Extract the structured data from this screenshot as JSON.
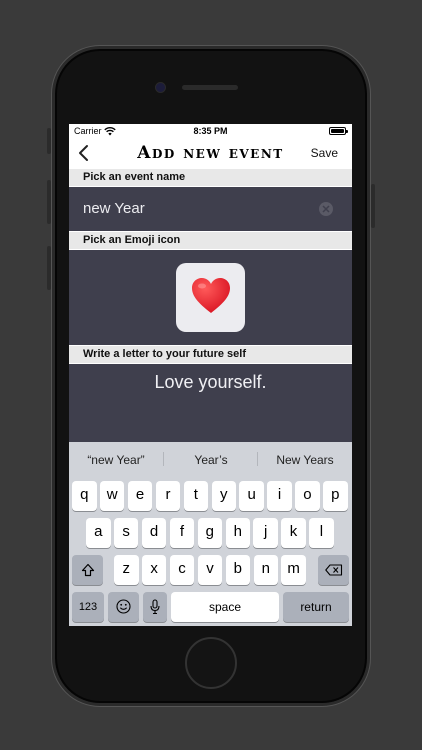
{
  "status_bar": {
    "carrier": "Carrier",
    "time": "8:35 PM"
  },
  "nav": {
    "title": "Add new event",
    "save_label": "Save"
  },
  "sections": {
    "event_name": "Pick an event name",
    "emoji": "Pick an Emoji icon",
    "letter": "Write a letter to your future self"
  },
  "event_name": {
    "value": "new Year"
  },
  "emoji": {
    "selected": "heart-icon",
    "color": "#e8182a"
  },
  "letter": {
    "text": "Love yourself."
  },
  "keyboard": {
    "suggestions": [
      "“new Year”",
      "Year’s",
      "New Years"
    ],
    "row1": [
      "q",
      "w",
      "e",
      "r",
      "t",
      "y",
      "u",
      "i",
      "o",
      "p"
    ],
    "row2": [
      "a",
      "s",
      "d",
      "f",
      "g",
      "h",
      "j",
      "k",
      "l"
    ],
    "row3": [
      "z",
      "x",
      "c",
      "v",
      "b",
      "n",
      "m"
    ],
    "numbers_label": "123",
    "space_label": "space",
    "return_label": "return"
  },
  "colors": {
    "panel": "#3f3f4d",
    "header": "#e8e8e8",
    "keyboard": "#d0d3d9"
  }
}
